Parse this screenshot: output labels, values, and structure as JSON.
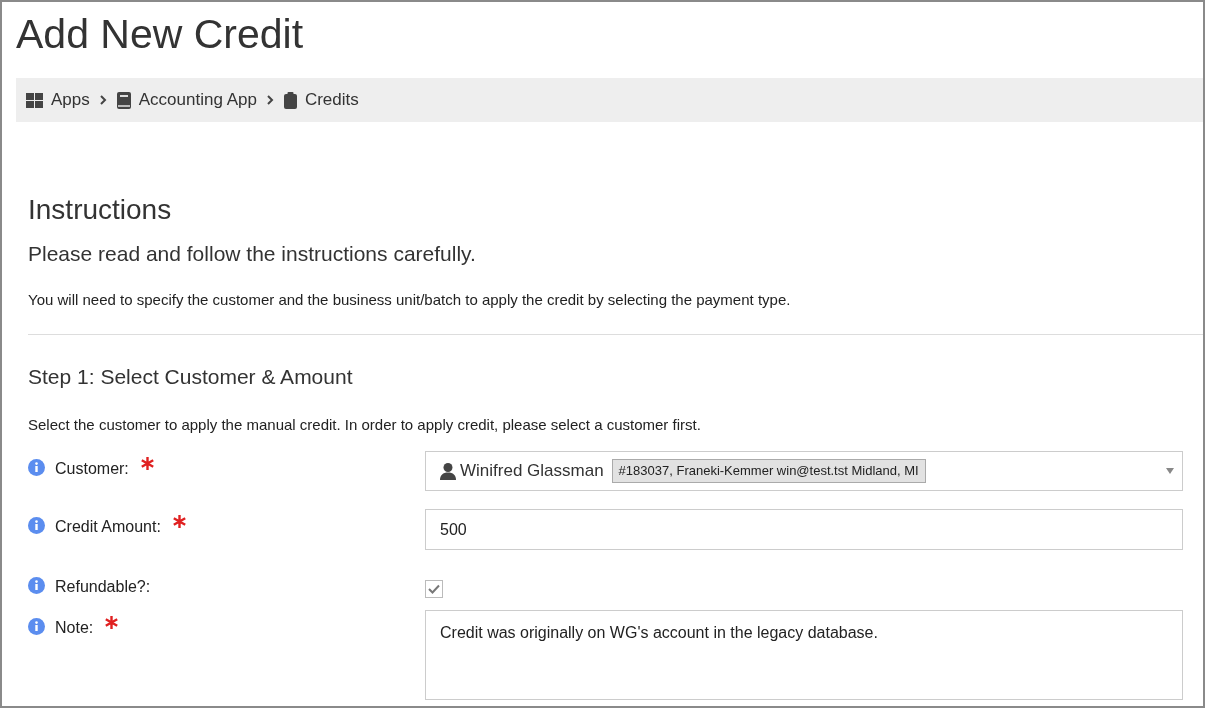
{
  "page_title": "Add New Credit",
  "breadcrumbs": [
    {
      "label": "Apps"
    },
    {
      "label": "Accounting App"
    },
    {
      "label": "Credits"
    }
  ],
  "instructions": {
    "title": "Instructions",
    "subtitle": "Please read and follow the instructions carefully.",
    "text": "You will need to specify the customer and the business unit/batch to apply the credit by selecting the payment type."
  },
  "step": {
    "title": "Step 1: Select Customer & Amount",
    "text": "Select the customer to apply the manual credit. In order to apply credit, please select a customer first."
  },
  "fields": [
    {
      "kind": "select",
      "label": "Customer:",
      "required": true,
      "value": "Winifred Glassman",
      "tag": "#183037, Franeki-Kemmer win@test.tst Midland, MI"
    },
    {
      "kind": "text",
      "label": "Credit Amount:",
      "required": true,
      "value": "500"
    },
    {
      "kind": "checkbox",
      "label": "Refundable?:",
      "required": false,
      "checked": true
    },
    {
      "kind": "textarea",
      "label": "Note:",
      "required": true,
      "value": "Credit was originally on WG's account in the legacy database."
    }
  ]
}
